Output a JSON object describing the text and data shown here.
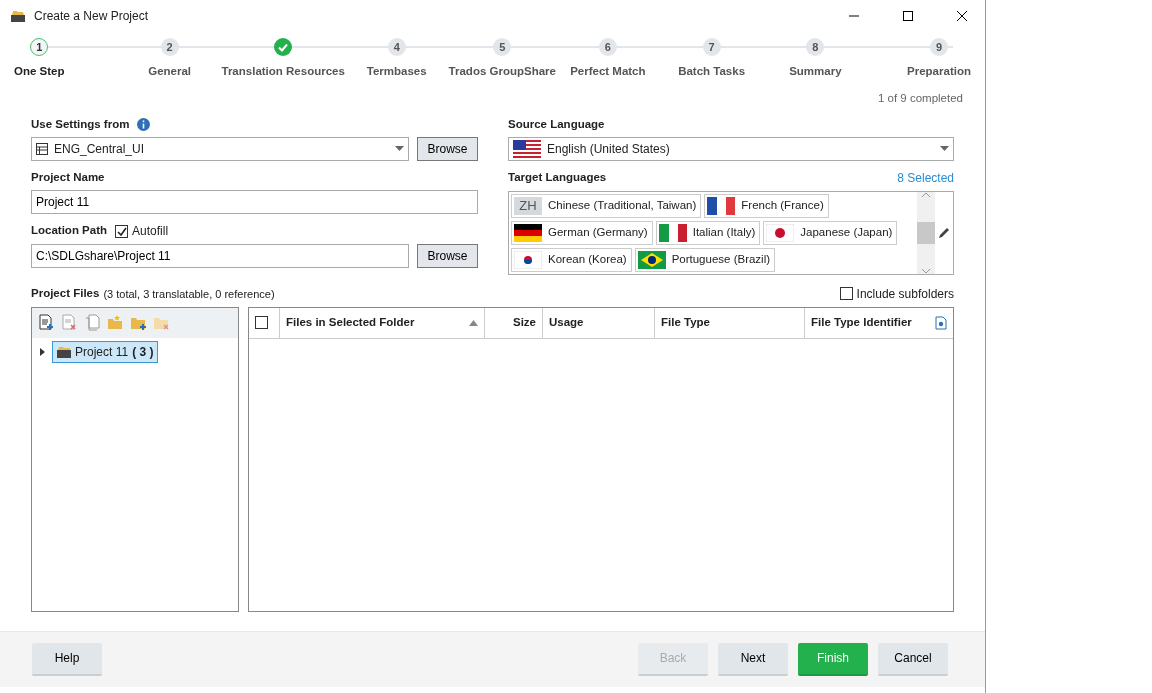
{
  "window": {
    "title": "Create a New Project"
  },
  "steps": [
    {
      "number": "1",
      "label": "One Step",
      "current": true,
      "done": false
    },
    {
      "number": "2",
      "label": "General",
      "current": false,
      "done": false
    },
    {
      "label": "Translation Resources",
      "current": false,
      "done": true
    },
    {
      "number": "4",
      "label": "Termbases",
      "current": false,
      "done": false
    },
    {
      "number": "5",
      "label": "Trados GroupShare",
      "current": false,
      "done": false
    },
    {
      "number": "6",
      "label": "Perfect Match",
      "current": false,
      "done": false
    },
    {
      "number": "7",
      "label": "Batch Tasks",
      "current": false,
      "done": false
    },
    {
      "number": "8",
      "label": "Summary",
      "current": false,
      "done": false
    },
    {
      "number": "9",
      "label": "Preparation",
      "current": false,
      "done": false
    }
  ],
  "progress_text": "1 of 9 completed",
  "use_settings": {
    "label": "Use Settings from",
    "value": "ENG_Central_UI",
    "button": "Browse"
  },
  "project_name": {
    "label": "Project Name",
    "value": "Project 11"
  },
  "location": {
    "label": "Location Path",
    "autofill_label": "Autofill",
    "autofill_checked": true,
    "value": "C:\\SDLGshare\\Project 11",
    "button": "Browse"
  },
  "source_language": {
    "label": "Source Language",
    "value": "English (United States)",
    "kind": "us"
  },
  "target_languages": {
    "label": "Target Languages",
    "count": "8 Selected",
    "items": [
      {
        "name": "Chinese (Traditional, Taiwan)",
        "kind": "code",
        "code": "ZH"
      },
      {
        "name": "French (France)",
        "kind": "fr"
      },
      {
        "name": "German (Germany)",
        "kind": "de"
      },
      {
        "name": "Italian (Italy)",
        "kind": "it"
      },
      {
        "name": "Japanese (Japan)",
        "kind": "jp"
      },
      {
        "name": "Korean (Korea)",
        "kind": "kr"
      },
      {
        "name": "Portuguese (Brazil)",
        "kind": "br"
      }
    ]
  },
  "project_files": {
    "label": "Project Files",
    "summary": "(3 total, 3 translatable, 0 reference)",
    "include_subfolders_label": "Include subfolders",
    "include_subfolders_checked": false,
    "tree": [
      {
        "name": "Project 11",
        "count": "( 3 )",
        "selected": true,
        "expanded": false
      }
    ],
    "columns": [
      "Files in Selected Folder",
      "Size",
      "Usage",
      "File Type",
      "File Type Identifier"
    ],
    "select_all_checked": false
  },
  "buttons": [
    {
      "label": "Help",
      "kind": "normal",
      "disabled": false
    },
    {
      "label": "Back",
      "kind": "normal",
      "disabled": true
    },
    {
      "label": "Next",
      "kind": "normal",
      "disabled": false
    },
    {
      "label": "Finish",
      "kind": "primary",
      "disabled": false
    },
    {
      "label": "Cancel",
      "kind": "normal",
      "disabled": false
    }
  ]
}
